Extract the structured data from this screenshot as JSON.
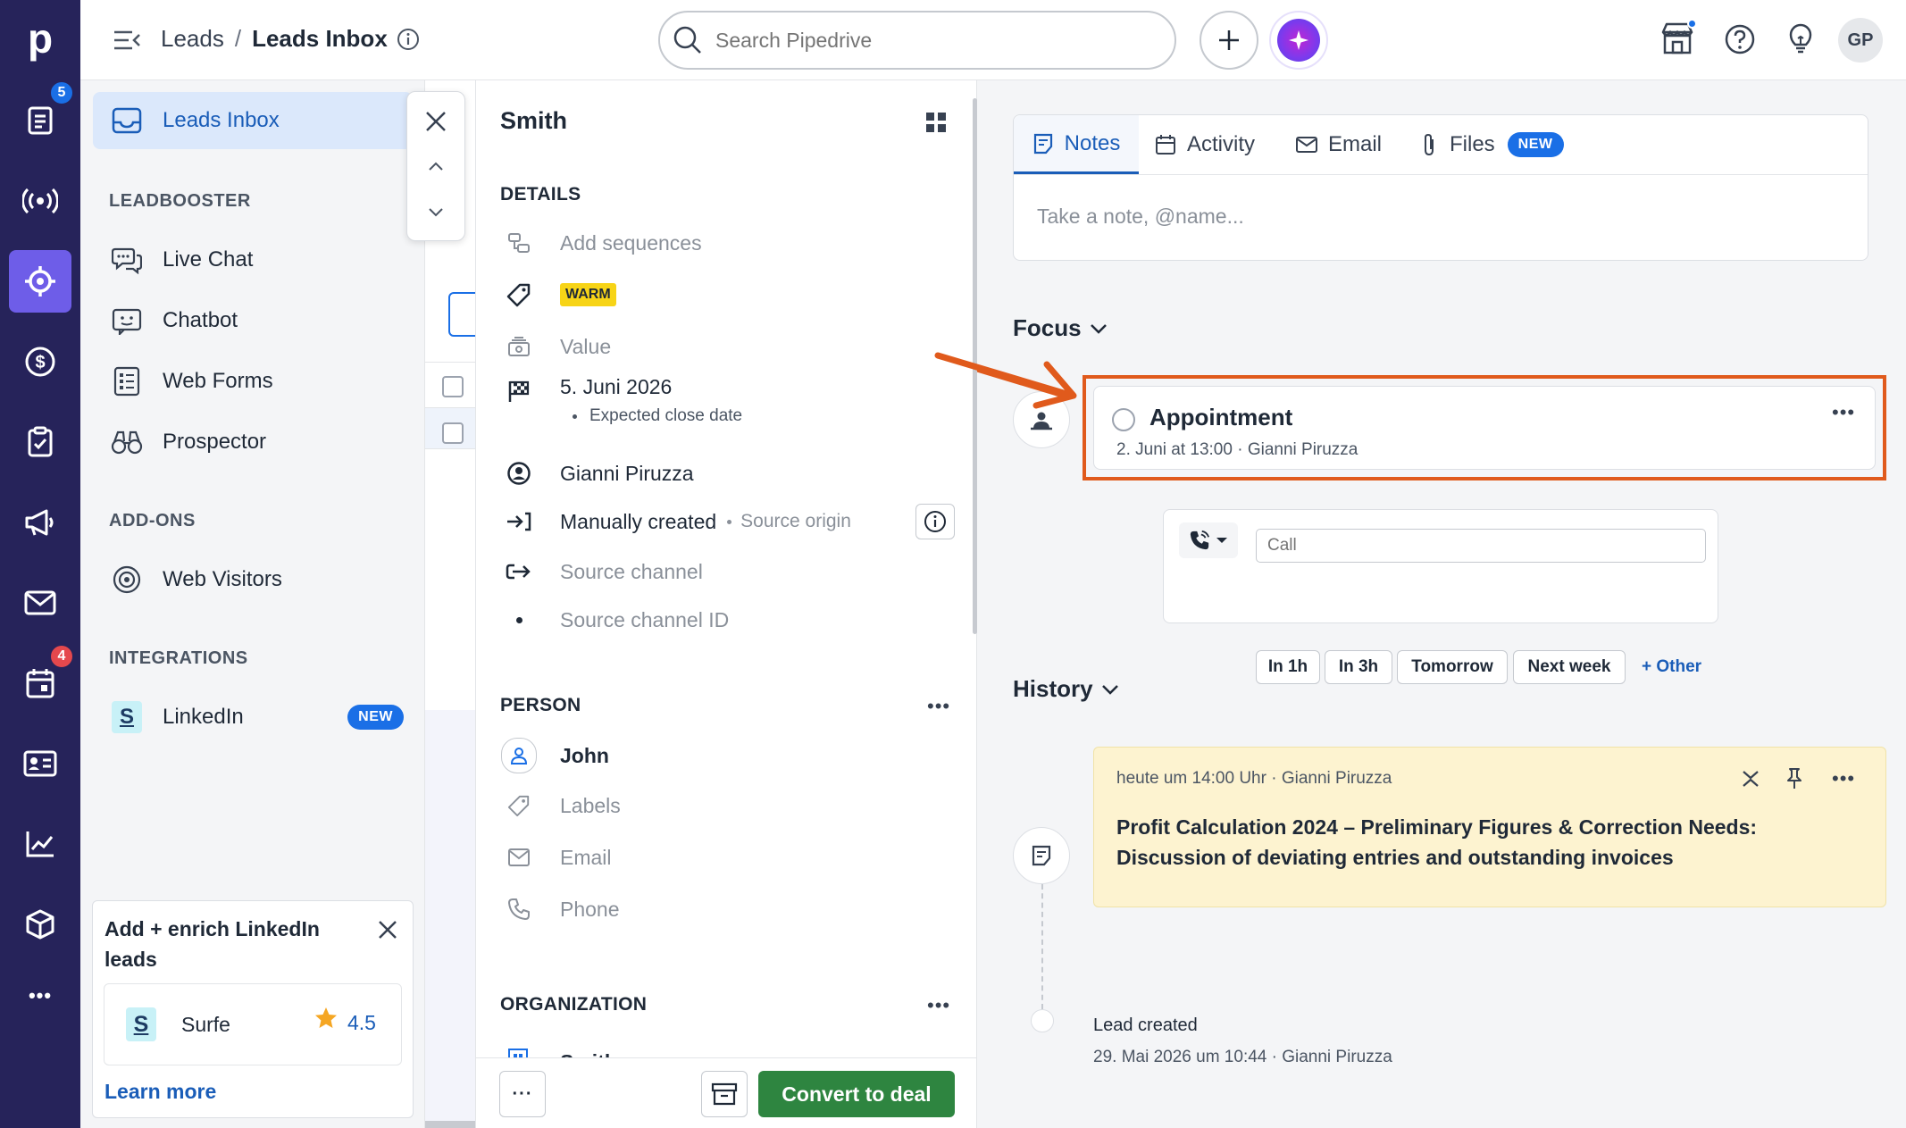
{
  "topbar": {
    "breadcrumb_parent": "Leads",
    "breadcrumb_sep": "/",
    "breadcrumb_current": "Leads Inbox",
    "search_placeholder": "Search Pipedrive",
    "avatar_initials": "GP"
  },
  "rail": {
    "logo": "p",
    "badges": {
      "leads": "5",
      "calendar": "4"
    },
    "more": "•••",
    "colors": {
      "background": "#26235a",
      "active": "#6e5de8"
    }
  },
  "sidebar": {
    "leads_inbox": "Leads Inbox",
    "leadbooster_header": "LEADBOOSTER",
    "leadbooster_items": [
      "Live Chat",
      "Chatbot",
      "Web Forms",
      "Prospector"
    ],
    "addons_header": "ADD-ONS",
    "addons_items": [
      "Web Visitors"
    ],
    "integrations_header": "INTEGRATIONS",
    "integrations_item": "LinkedIn",
    "integrations_badge": "NEW",
    "promo": {
      "title": "Add + enrich LinkedIn leads",
      "app_name": "Surfe",
      "app_logo_letter": "S",
      "rating": "4.5",
      "link": "Learn more"
    }
  },
  "detail": {
    "title": "Smith",
    "details_header": "DETAILS",
    "add_sequences": "Add sequences",
    "label_warm": "WARM",
    "value_placeholder": "Value",
    "close_date": "5. Juni 2026",
    "close_date_caption": "Expected close date",
    "owner": "Gianni Piruzza",
    "source_origin_value": "Manually created",
    "source_origin_label": "Source origin",
    "source_channel": "Source channel",
    "source_channel_id": "Source channel ID",
    "person_header": "PERSON",
    "person_name": "John",
    "person_labels": "Labels",
    "person_email": "Email",
    "person_phone": "Phone",
    "organization_header": "ORGANIZATION",
    "organization_name": "Smith",
    "more_button": "···",
    "convert_button": "Convert to deal"
  },
  "activity": {
    "tabs": [
      "Notes",
      "Activity",
      "Email",
      "Files"
    ],
    "files_badge": "NEW",
    "note_placeholder": "Take a note, @name...",
    "focus_title": "Focus",
    "focus_item": {
      "title": "Appointment",
      "meta": "2. Juni at 13:00 · Gianni Piruzza"
    },
    "quick_call": {
      "placeholder": "Call",
      "options": [
        "In 1h",
        "In 3h",
        "Tomorrow",
        "Next week"
      ],
      "other": "+ Other"
    },
    "history_title": "History",
    "history_note": {
      "meta": "heute um 14:00 Uhr · Gianni Piruzza",
      "text": "Profit Calculation 2024 – Preliminary Figures & Correction Needs: Discussion of deviating entries and outstanding invoices"
    },
    "history_created": {
      "title": "Lead created",
      "meta": "29. Mai 2026 um 10:44 · Gianni Piruzza"
    }
  },
  "annotation": {
    "arrow_color": "#e05a1c",
    "highlight_color": "#e05a1c"
  }
}
